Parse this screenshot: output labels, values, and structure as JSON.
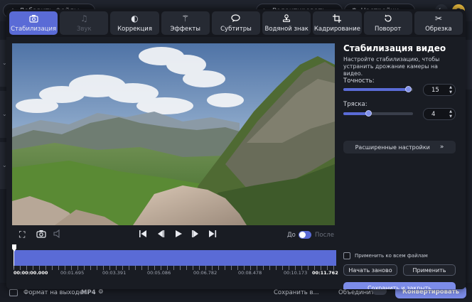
{
  "background": {
    "add_files_label": "Добавить файлы",
    "edit_label": "Редактировать",
    "settings_label": "Настройки",
    "format_label": "Формат на выходе:",
    "format_value": "MP4",
    "save_in_label": "Сохранить в...",
    "merge_label": "Объединить",
    "convert_label": "Конвертировать"
  },
  "toolbar": {
    "items": [
      {
        "label": "Стабилизация",
        "icon": "stabilization-camera-icon"
      },
      {
        "label": "Звук",
        "icon": "music-note-icon"
      },
      {
        "label": "Коррекция",
        "icon": "contrast-icon"
      },
      {
        "label": "Эффекты",
        "icon": "magic-wand-icon"
      },
      {
        "label": "Субтитры",
        "icon": "speech-bubble-icon"
      },
      {
        "label": "Водяной знак",
        "icon": "stamp-icon"
      },
      {
        "label": "Кадрирование",
        "icon": "crop-icon"
      },
      {
        "label": "Поворот",
        "icon": "rotate-icon"
      },
      {
        "label": "Обрезка",
        "icon": "scissors-icon"
      }
    ],
    "active_index": 0,
    "disabled_index": 1
  },
  "player": {
    "before_label": "До",
    "after_label": "После"
  },
  "timeline": {
    "position_fraction": 0.0,
    "ticks": [
      "00:00:00.000",
      "00:01.695",
      "00:03.391",
      "00:05.086",
      "00:06.782",
      "00:08.478",
      "00:10.173",
      "00:11.762"
    ]
  },
  "panel": {
    "title": "Стабилизация видео",
    "description": "Настройте стабилизацию, чтобы устранить дрожание камеры на видео.",
    "accuracy": {
      "label": "Точность:",
      "value": "15",
      "level": 0.93
    },
    "shake": {
      "label": "Тряска:",
      "value": "4",
      "level": 0.36
    },
    "advanced_label": "Расширенные настройки",
    "apply_all_label": "Применить ко всем файлам",
    "reset_label": "Начать заново",
    "apply_label": "Применить",
    "save_close_label": "Сохранить и закрыть"
  },
  "colors": {
    "accent": "#5a6bd6",
    "primary_button": "#7c8ce9",
    "modal_bg": "#191c23"
  }
}
